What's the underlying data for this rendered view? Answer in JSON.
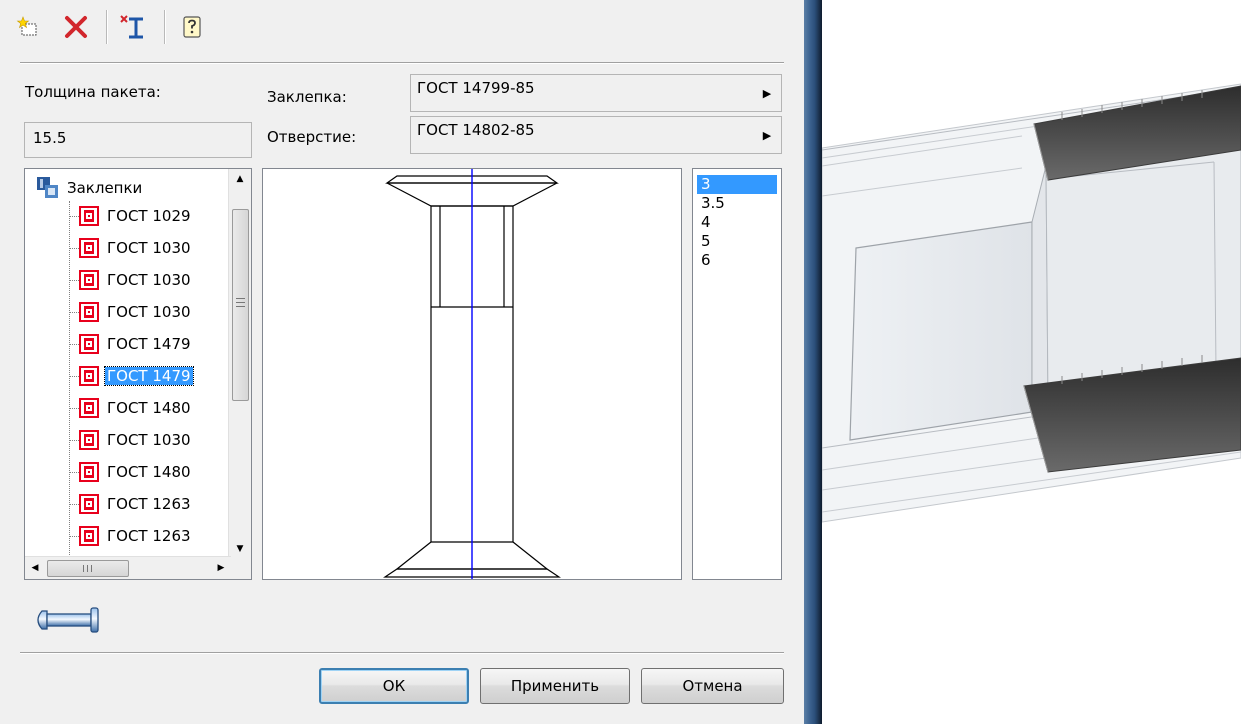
{
  "toolbar": {
    "buttons": [
      {
        "name": "new-icon",
        "tooltip": ""
      },
      {
        "name": "delete-icon",
        "tooltip": ""
      },
      {
        "name": "insert-rivet-icon",
        "tooltip": ""
      },
      {
        "name": "help-icon",
        "tooltip": ""
      }
    ]
  },
  "form": {
    "thickness_label": "Толщина пакета:",
    "thickness_value": "15.5",
    "rivet_label": "Заклепка:",
    "rivet_value": "ГОСТ 14799-85",
    "hole_label": "Отверстие:",
    "hole_value": "ГОСТ 14802-85"
  },
  "tree": {
    "root_label": "Заклепки",
    "items": [
      {
        "label": "ГОСТ 1029",
        "selected": false
      },
      {
        "label": "ГОСТ 1030",
        "selected": false
      },
      {
        "label": "ГОСТ 1030",
        "selected": false
      },
      {
        "label": "ГОСТ 1030",
        "selected": false
      },
      {
        "label": "ГОСТ 1479",
        "selected": false
      },
      {
        "label": "ГОСТ 1479",
        "selected": true
      },
      {
        "label": "ГОСТ 1480",
        "selected": false
      },
      {
        "label": "ГОСТ 1030",
        "selected": false
      },
      {
        "label": "ГОСТ 1480",
        "selected": false
      },
      {
        "label": "ГОСТ 1263",
        "selected": false
      },
      {
        "label": "ГОСТ 1263",
        "selected": false
      }
    ]
  },
  "sizes": {
    "items": [
      "3",
      "3.5",
      "4",
      "5",
      "6"
    ],
    "selected": "3"
  },
  "buttons": {
    "ok": "ОК",
    "apply": "Применить",
    "cancel": "Отмена"
  },
  "colors": {
    "selection": "#3399ff",
    "axis_line": "#0000ff",
    "gost_icon": "#e8001c"
  }
}
